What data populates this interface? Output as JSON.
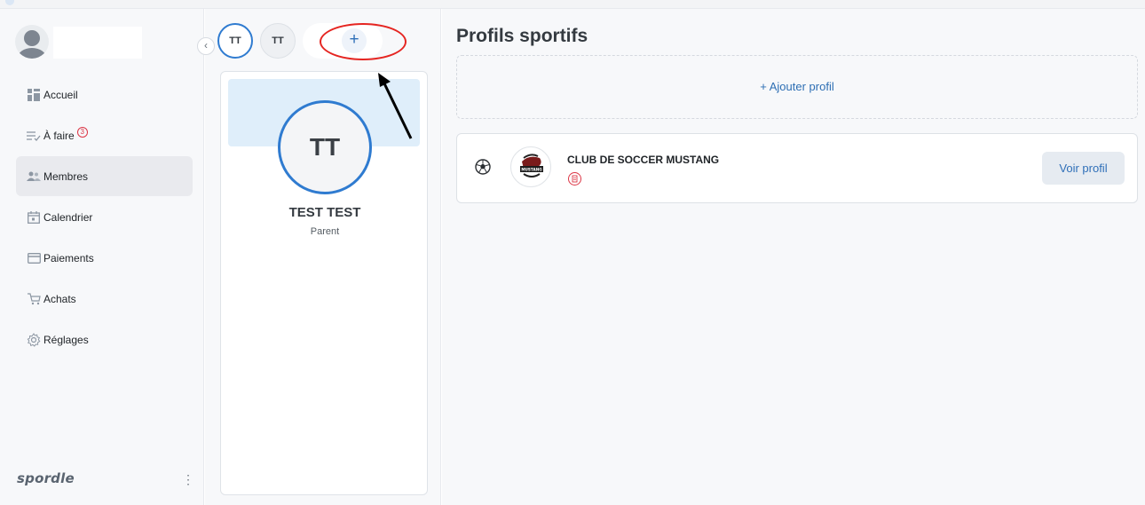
{
  "sidebar": {
    "items": [
      {
        "label": "Accueil",
        "icon": "grid-icon"
      },
      {
        "label": "À faire",
        "icon": "todo-list-icon",
        "badge": "3"
      },
      {
        "label": "Membres",
        "icon": "members-icon",
        "active": true
      },
      {
        "label": "Calendrier",
        "icon": "calendar-icon"
      },
      {
        "label": "Paiements",
        "icon": "credit-card-icon"
      },
      {
        "label": "Achats",
        "icon": "cart-icon"
      },
      {
        "label": "Réglages",
        "icon": "gear-icon"
      }
    ],
    "brand": "spordle",
    "menu_glyph": "⋮",
    "collapse_glyph": "‹"
  },
  "members": {
    "chips": [
      "TT",
      "TT"
    ],
    "add_glyph": "+",
    "card": {
      "initials": "TT",
      "name": "TEST TEST",
      "role": "Parent"
    }
  },
  "main": {
    "title": "Profils sportifs",
    "add_profile": "+ Ajouter profil",
    "club": {
      "name": "CLUB DE SOCCER MUSTANG",
      "logo_text": "MUSTANG",
      "button": "Voir profil"
    }
  },
  "colors": {
    "accent": "#2f7bd0",
    "link": "#2e6fb4",
    "alert": "#dc3545",
    "annotation_red": "#e52521"
  }
}
